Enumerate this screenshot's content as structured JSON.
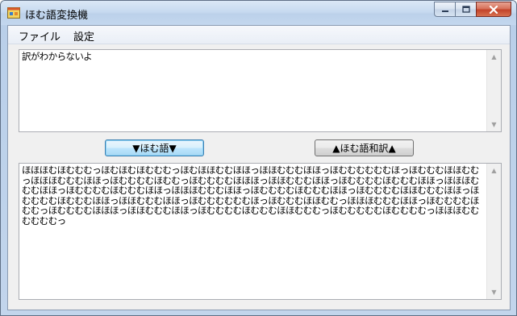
{
  "window": {
    "title": "ほむ語変換機",
    "icon": "app-window-icon"
  },
  "menu": {
    "items": [
      "ファイル",
      "設定"
    ]
  },
  "input": {
    "value": "訳がわからないよ"
  },
  "buttons": {
    "encode_label": "▼ほむ語▼",
    "decode_label": "▲ほむ語和訳▲"
  },
  "output": {
    "value": "ほほほむほむむむっほむほむほむむむっほむほほむむほほっほほむむむほほっほむむむむむむほっほむむむほほむむっほほほむむむほほっほむむむむほむむっほむむむむほほほっほほむむむほほっほむむむむほむむむほほっほほほむむむほほっほむむむむほむむむほほっほほほむむむほほっほむむむむほむむむほほっほむむむむほほむむむほほっほむむむむほむむむほほっほほむむむほほっほむむむむむむほっほむむむほほむむっほほほむむむほほっほむむむむほむむっほむむむむほほほっほほむむむほほっほむむむむほむむむほほむむむっほむむむむむほむむむむっほほほむむむむむむっ"
  },
  "colors": {
    "titlebar": "#c6d9ef",
    "close_button": "#c3432a",
    "focus_border": "#3c7fb1"
  }
}
